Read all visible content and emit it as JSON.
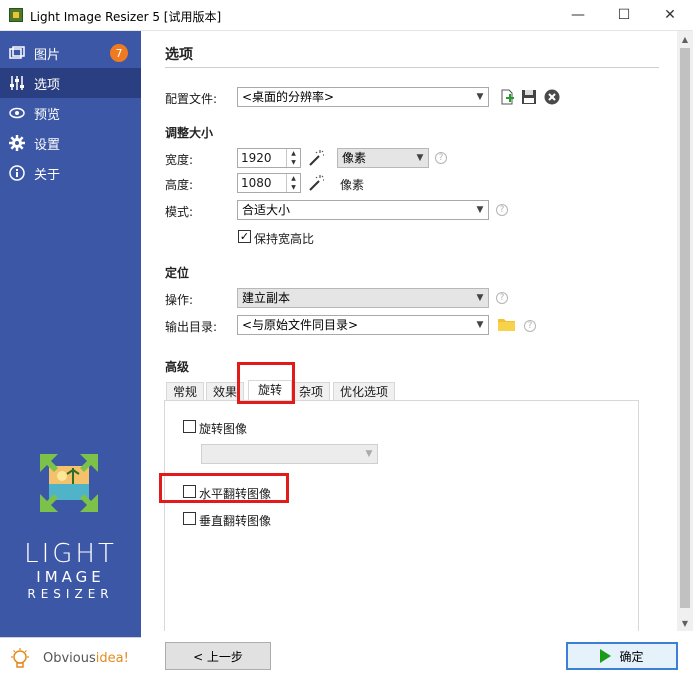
{
  "window": {
    "title": "Light Image Resizer 5  [试用版本]",
    "minimize": "—",
    "maximize": "☐",
    "close": "✕"
  },
  "sidebar": {
    "items": [
      {
        "label": "图片",
        "icon": "images-icon",
        "badge": "7"
      },
      {
        "label": "选项",
        "icon": "sliders-icon",
        "active": true
      },
      {
        "label": "预览",
        "icon": "eye-icon"
      },
      {
        "label": "设置",
        "icon": "gear-icon"
      },
      {
        "label": "关于",
        "icon": "info-icon"
      }
    ],
    "logo": {
      "line1": "LIGHT",
      "line2": "IMAGE",
      "line3": "RESIZER"
    },
    "brand": {
      "prefix": "Obvious",
      "suffix": "idea!"
    }
  },
  "main": {
    "title": "选项",
    "profile": {
      "label": "配置文件:",
      "value": "<桌面的分辨率>"
    },
    "resize": {
      "heading": "调整大小",
      "width_label": "宽度:",
      "width_value": "1920",
      "unit_select": "像素",
      "height_label": "高度:",
      "height_value": "1080",
      "unit_text": "像素",
      "mode_label": "模式:",
      "mode_value": "合适大小",
      "keep_ratio_label": "保持宽高比",
      "keep_ratio_checked": true
    },
    "target": {
      "heading": "定位",
      "action_label": "操作:",
      "action_value": "建立副本",
      "output_label": "输出目录:",
      "output_value": "<与原始文件同目录>"
    },
    "advanced": {
      "heading": "高级",
      "tabs": [
        "常规",
        "效果",
        "旋转",
        "杂项",
        "优化选项"
      ],
      "active_tab": "旋转",
      "rotate_image_label": "旋转图像",
      "rotate_image_checked": false,
      "rotate_select": "",
      "flip_h_label": "水平翻转图像",
      "flip_h_checked": false,
      "flip_v_label": "垂直翻转图像",
      "flip_v_checked": false
    }
  },
  "footer": {
    "back_label": "< 上一步",
    "ok_label": "确定"
  },
  "colors": {
    "sidebar": "#3b57a6",
    "sidebar_active": "#2a3f82",
    "badge": "#f07a20",
    "highlight": "#e11a1a",
    "ok_border": "#3c7fd6"
  }
}
